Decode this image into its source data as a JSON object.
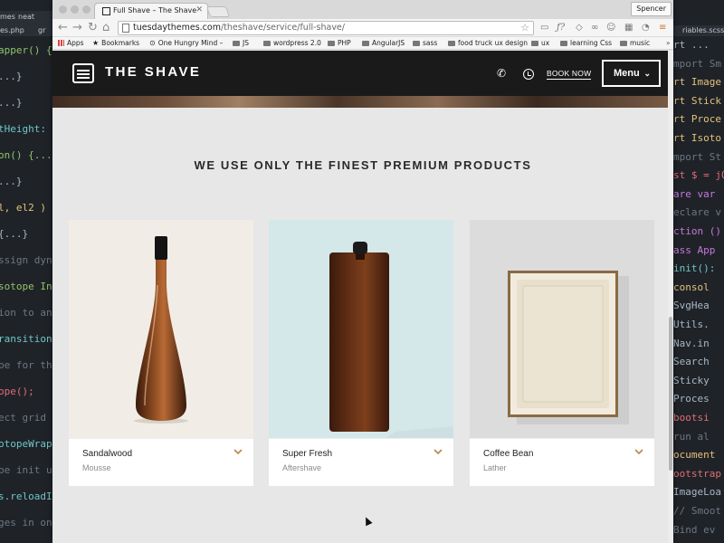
{
  "editor_left": {
    "tabs": [
      "mes",
      "neat",
      "es.php",
      "gr"
    ],
    "code_lines": [
      {
        "text": "apper() {",
        "color": "#8fc46b"
      },
      {
        "text": "...}",
        "color": "#a9b7c6"
      },
      {
        "text": "...}",
        "color": "#a9b7c6"
      },
      {
        "text": "tHeight: s",
        "color": "#6ec6c8"
      },
      {
        "text": "on() {...}",
        "color": "#8fc46b"
      },
      {
        "text": "...}",
        "color": "#a9b7c6"
      },
      {
        "text": "l, el2 )",
        "color": "#e6c07b"
      },
      {
        "text": "{...}",
        "color": "#a9b7c6"
      },
      {
        "text": "ssign dyn",
        "color": "#6d7681"
      },
      {
        "text": "sotope In",
        "color": "#8fc46b"
      },
      {
        "text": "ion to ani",
        "color": "#6d7681"
      },
      {
        "text": "ransition(",
        "color": "#6ec6c8"
      },
      {
        "text": "pe for th",
        "color": "#6d7681"
      },
      {
        "text": "ope();",
        "color": "#e06c75"
      },
      {
        "text": "ect grid",
        "color": "#6d7681"
      },
      {
        "text": "otopeWrapp",
        "color": "#6ec6c8"
      },
      {
        "text": "pe init u",
        "color": "#6d7681"
      },
      {
        "text": "s.reloadI",
        "color": "#6ec6c8"
      },
      {
        "text": "ges in on",
        "color": "#6d7681"
      }
    ]
  },
  "editor_right": {
    "tabs": [
      "riables.scss"
    ],
    "code_lines": [
      {
        "text": "rt ...",
        "color": "#a9b7c6"
      },
      {
        "text": "mport Sm",
        "color": "#6d7681"
      },
      {
        "text": "rt Image",
        "color": "#e6c07b"
      },
      {
        "text": "rt Stick",
        "color": "#e6c07b"
      },
      {
        "text": "rt Proce",
        "color": "#e6c07b"
      },
      {
        "text": "rt Isoto",
        "color": "#e6c07b"
      },
      {
        "text": "mport St",
        "color": "#6d7681"
      },
      {
        "text": "st $ = jQ",
        "color": "#e06c75"
      },
      {
        "text": "are var",
        "color": "#c678dd"
      },
      {
        "text": "eclare v",
        "color": "#6d7681"
      },
      {
        "text": "ction ()",
        "color": "#c678dd"
      },
      {
        "text": "ass App",
        "color": "#c678dd"
      },
      {
        "text": "init():",
        "color": "#6ec6c8"
      },
      {
        "text": "consol",
        "color": "#e6c07b"
      },
      {
        "text": "SvgHea",
        "color": "#a9b7c6"
      },
      {
        "text": "Utils.",
        "color": "#a9b7c6"
      },
      {
        "text": "Nav.in",
        "color": "#a9b7c6"
      },
      {
        "text": "Search",
        "color": "#a9b7c6"
      },
      {
        "text": "Sticky",
        "color": "#a9b7c6"
      },
      {
        "text": "Proces",
        "color": "#a9b7c6"
      },
      {
        "text": "bootsi",
        "color": "#e06c75"
      },
      {
        "text": "run al",
        "color": "#6d7681"
      },
      {
        "text": "ocument",
        "color": "#e6c07b"
      },
      {
        "text": "ootstrap",
        "color": "#e06c75"
      },
      {
        "text": "ImageLoa",
        "color": "#a9b7c6"
      },
      {
        "text": "// Smoot",
        "color": "#6d7681"
      },
      {
        "text": "Bind ev",
        "color": "#6d7681"
      }
    ]
  },
  "browser": {
    "tab_title": "Full Shave – The Shave",
    "profile_label": "Spencer",
    "url_host": "tuesdaythemes.com",
    "url_path": "/theshave/service/full-shave/",
    "bookmarks": [
      {
        "label": "Apps",
        "type": "apps"
      },
      {
        "label": "Bookmarks",
        "type": "star"
      },
      {
        "label": "One Hungry Mind –",
        "type": "page"
      },
      {
        "label": "JS",
        "type": "folder"
      },
      {
        "label": "wordpress 2.0",
        "type": "folder"
      },
      {
        "label": "PHP",
        "type": "folder"
      },
      {
        "label": "AngularJS",
        "type": "folder"
      },
      {
        "label": "sass",
        "type": "folder"
      },
      {
        "label": "food truck ux design",
        "type": "folder"
      },
      {
        "label": "ux",
        "type": "folder"
      },
      {
        "label": "learning Css",
        "type": "folder"
      },
      {
        "label": "music",
        "type": "folder"
      }
    ],
    "bookmarks_overflow": "»"
  },
  "site": {
    "logo_text": "THE SHAVE",
    "book_now": "BOOK NOW",
    "menu_label": "Menu",
    "section_title": "WE USE ONLY THE FINEST PREMIUM PRODUCTS",
    "products": [
      {
        "name": "Sandalwood",
        "type": "Mousse",
        "bg": "#f1ede6",
        "kind": "bottle"
      },
      {
        "name": "Super Fresh",
        "type": "Aftershave",
        "bg": "#d4e7e9",
        "kind": "flask"
      },
      {
        "name": "Coffee Bean",
        "type": "Lather",
        "bg": "#dcdcdc",
        "kind": "soap"
      }
    ]
  },
  "colors": {
    "header_bg": "#1a1a1a",
    "page_bg": "#e7e7e7",
    "accent_chevron": "#b8874a"
  }
}
